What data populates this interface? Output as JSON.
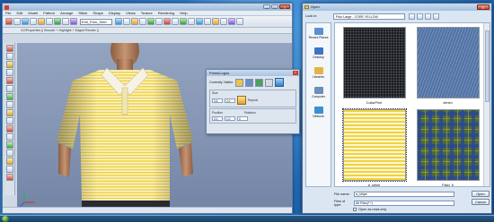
{
  "app": {
    "title": "",
    "menu": [
      "File",
      "Edit",
      "Model",
      "Pattern",
      "Arrange",
      "Stitch",
      "Shape",
      "Display",
      "Views",
      "Texture",
      "Rendering",
      "Help"
    ],
    "file_field": "Emi_Polo_Shirt",
    "info_line": "3-DProperties || Smooth + Highlight + Edged Render ||",
    "status_left": "",
    "status_mid": "",
    "status_right": "",
    "colors": {
      "viewport": "#8796b5",
      "stripe_yellow": "#f2d33a",
      "stripe_white": "#f7f4df"
    }
  },
  "prints_panel": {
    "title": "Prints/Logos",
    "currently_visible": "Currently Visible:",
    "size_label": "Size",
    "position_label": "Position",
    "repeat_label": "Repeat",
    "rotation_label": "Rotation",
    "fields": [
      "3.5",
      "2.0",
      "2.0",
      "1.0",
      "0"
    ]
  },
  "open_dialog": {
    "title": "Open",
    "close_label": "X",
    "look_in_label": "Look in:",
    "look_in_value": "Polo Large - CORE YELLOW",
    "places": [
      {
        "label": "Recent Places",
        "icon": "recent-places-icon",
        "color": "#5a8fd0"
      },
      {
        "label": "Desktop",
        "icon": "desktop-icon",
        "color": "#3c74c2"
      },
      {
        "label": "Libraries",
        "icon": "libraries-icon",
        "color": "#e0b548"
      },
      {
        "label": "Computer",
        "icon": "computer-icon",
        "color": "#6b8fb8"
      },
      {
        "label": "Network",
        "icon": "network-icon",
        "color": "#3c8fd0"
      }
    ],
    "files": [
      {
        "name": "CollarPrint",
        "pattern": "dark-dots"
      },
      {
        "name": "denim",
        "pattern": "denim"
      },
      {
        "name": "a_stripe",
        "pattern": "yellow-stripe"
      },
      {
        "name": "Plaid_6",
        "pattern": "plaid"
      }
    ],
    "file_name_label": "File name:",
    "file_name_value": "a_stripe",
    "file_type_label": "Files of type:",
    "file_type_value": "All Files(*.*)",
    "readonly_label": "Open as read-only",
    "open_button": "Open",
    "cancel_button": "Cancel"
  }
}
